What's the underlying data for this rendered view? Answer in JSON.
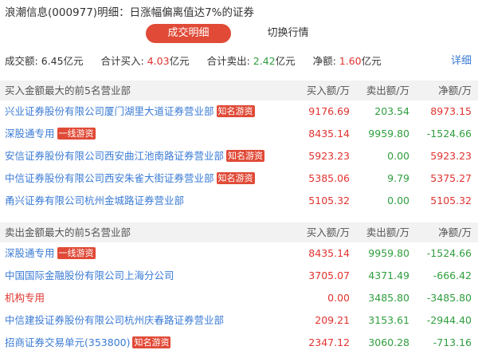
{
  "header": {
    "title": "浪潮信息(000977)明细：日涨幅偏离值达7%的证券"
  },
  "tabs": [
    {
      "label": "成交明细",
      "active": true
    },
    {
      "label": "切换行情",
      "active": false
    }
  ],
  "summary": {
    "turnover_label": "成交额:",
    "turnover_value": "6.45",
    "turnover_unit": "亿元",
    "buy_label": "合计买入:",
    "buy_value": "4.03",
    "buy_unit": "亿元",
    "sell_label": "合计卖出:",
    "sell_value": "2.42",
    "sell_unit": "亿元",
    "net_label": "净额:",
    "net_value": "1.60",
    "net_unit": "亿元",
    "detail_link": "详细"
  },
  "buy_section": {
    "headers": [
      "买入金额最大的前5名营业部",
      "买入额/万",
      "卖出额/万",
      "净额/万"
    ],
    "rows": [
      {
        "name": "兴业证券股份有限公司厦门湖里大道证券营业部",
        "badge": "知名游资",
        "buy": "9176.69",
        "sell": "203.54",
        "net": "8973.15"
      },
      {
        "name": "深股通专用",
        "badge": "一线游资",
        "buy": "8435.14",
        "sell": "9959.80",
        "net": "-1524.66"
      },
      {
        "name": "安信证券股份有限公司西安曲江池南路证券营业部",
        "badge": "知名游资",
        "buy": "5923.23",
        "sell": "0.00",
        "net": "5923.23"
      },
      {
        "name": "中信证券股份有限公司西安朱雀大街证券营业部",
        "badge": "知名游资",
        "buy": "5385.06",
        "sell": "9.79",
        "net": "5375.27"
      },
      {
        "name": "甬兴证券有限公司杭州金城路证券营业部",
        "badge": "",
        "buy": "5105.32",
        "sell": "0.00",
        "net": "5105.32"
      }
    ]
  },
  "sell_section": {
    "headers": [
      "卖出金额最大的前5名营业部",
      "买入额/万",
      "卖出额/万",
      "净额/万"
    ],
    "rows": [
      {
        "name": "深股通专用",
        "badge": "一线游资",
        "buy": "8435.14",
        "sell": "9959.80",
        "net": "-1524.66",
        "orange": false
      },
      {
        "name": "中国国际金融股份有限公司上海分公司",
        "badge": "",
        "buy": "3705.07",
        "sell": "4371.49",
        "net": "-666.42",
        "orange": false
      },
      {
        "name": "机构专用",
        "badge": "",
        "buy": "0.00",
        "sell": "3485.80",
        "net": "-3485.80",
        "orange": true
      },
      {
        "name": "中信建投证券股份有限公司杭州庆春路证券营业部",
        "badge": "",
        "buy": "209.21",
        "sell": "3153.61",
        "net": "-2944.40",
        "orange": false
      },
      {
        "name": "招商证券交易单元(353800)",
        "badge": "知名游资",
        "buy": "2347.12",
        "sell": "3060.28",
        "net": "-713.16",
        "orange": false
      }
    ]
  },
  "colors": {
    "accent": "#e04a37",
    "link": "#3a7bd5",
    "positive": "#e0332f",
    "negative": "#2f9e3e"
  }
}
